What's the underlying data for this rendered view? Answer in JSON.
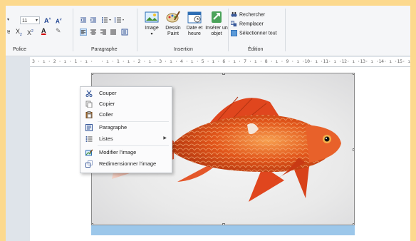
{
  "ribbon": {
    "font": {
      "size_value": "11",
      "group_label": "Police"
    },
    "paragraph": {
      "group_label": "Paragraphe"
    },
    "insert": {
      "image_label": "Image",
      "paint_label": "Dessin Paint",
      "datetime_label": "Date et heure",
      "object_label": "Insérer un objet",
      "group_label": "Insertion"
    },
    "edit": {
      "find_label": "Rechercher",
      "replace_label": "Remplacer",
      "select_all_label": "Sélectionner tout",
      "group_label": "Édition"
    }
  },
  "ruler": {
    "text": "3 · ı · 2 · ı · 1 · ı ·   · ı · 1 · ı · 2 · ı · 3 · ı · 4 · ı · 5 · ı · 6 · ı · 7 · ı · 8 · ı · 9 · ı ·10· ı ·11· ı ·12· ı ·13· ı ·14· ı ·15· ı ·16· ı"
  },
  "context_menu": {
    "items": [
      {
        "label": "Couper",
        "icon": "scissors-icon"
      },
      {
        "label": "Copier",
        "icon": "copy-icon"
      },
      {
        "label": "Coller",
        "icon": "paste-icon"
      },
      {
        "label": "Paragraphe",
        "icon": "paragraph-icon"
      },
      {
        "label": "Listes",
        "icon": "list-icon"
      },
      {
        "label": "Modifier l'image",
        "icon": "edit-image-icon"
      },
      {
        "label": "Redimensionner l'image",
        "icon": "resize-image-icon"
      }
    ]
  },
  "colors": {
    "outer_border": "#fcd98e",
    "ribbon_bg": "#f5f6f8",
    "selection_strip": "#9cc7ea",
    "fish_orange": "#e2561b"
  }
}
